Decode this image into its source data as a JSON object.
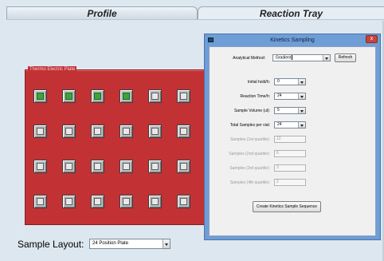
{
  "tabs": {
    "profile": "Profile",
    "reaction_tray": "Reaction Tray"
  },
  "plate": {
    "legend": "Thermo Electric Plate",
    "rows": 4,
    "cols": 6,
    "active_wells": [
      0,
      1,
      2,
      3
    ]
  },
  "sample_layout": {
    "label": "Sample Layout:",
    "value": "24 Position Plate"
  },
  "dialog": {
    "title": "Kinetics Sampling",
    "close_glyph": "x",
    "analytical_method_label": "Analytical Method:",
    "analytical_method_value": "Gradient",
    "refresh_label": "Refresh",
    "initial_hold_label": "Initial hold/h:",
    "initial_hold_value": "0",
    "reaction_time_label": "Reaction Time/h:",
    "reaction_time_value": "24",
    "sample_volume_label": "Sample Volume (ul):",
    "sample_volume_value": "5",
    "total_samples_label": "Total Samples per vial:",
    "total_samples_value": "24",
    "q1_label": "Samples (1st quartile):",
    "q1_value": "12",
    "q2_label": "Samples (2nd quartile):",
    "q2_value": "6",
    "q3_label": "Samples (3rd quartile):",
    "q3_value": "3",
    "q4_label": "Samples (4th quartile):",
    "q4_value": "2",
    "create_button_label": "Create Kinetics Sample Sequence"
  },
  "colors": {
    "plate_red": "#c23234",
    "well_active": "#3ea33b",
    "dialog_frame": "#6f9dd6",
    "background": "#dce7ef"
  }
}
